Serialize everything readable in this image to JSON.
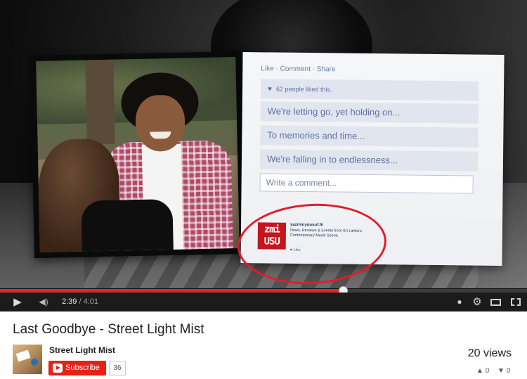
{
  "video": {
    "fb_panel": {
      "actions": "Like · Comment · Share",
      "likes": "62 people liked this.",
      "lines": [
        "We're letting go, yet holding on...",
        "To memories and time...",
        "We're falling in to endlessness..."
      ],
      "comment_placeholder": "Write a comment..."
    },
    "promo": {
      "logo_top": "zmi",
      "logo_bottom": "USU",
      "site": "yazminyousuf.lk",
      "text": "News, Reviews & Events from Sri Lanka's Contemporary Music Scene.",
      "like": "Like"
    }
  },
  "player": {
    "progress_fraction": 0.65,
    "buffered_fraction": 0.66,
    "current_time": "2:39",
    "total_time": "4:01",
    "time_separator": "/",
    "icons": {
      "play": "play-icon",
      "volume": "volume-icon",
      "watch_later": "clock-icon",
      "settings": "gear-icon",
      "theater": "theater-icon",
      "fullscreen": "fullscreen-icon"
    },
    "accent_color": "#e0262b"
  },
  "info": {
    "title": "Last Goodbye - Street Light Mist",
    "channel": "Street Light Mist",
    "subscribe_label": "Subscribe",
    "subscriber_count": "36",
    "views": "20 views",
    "likes": "0",
    "dislikes": "0"
  }
}
